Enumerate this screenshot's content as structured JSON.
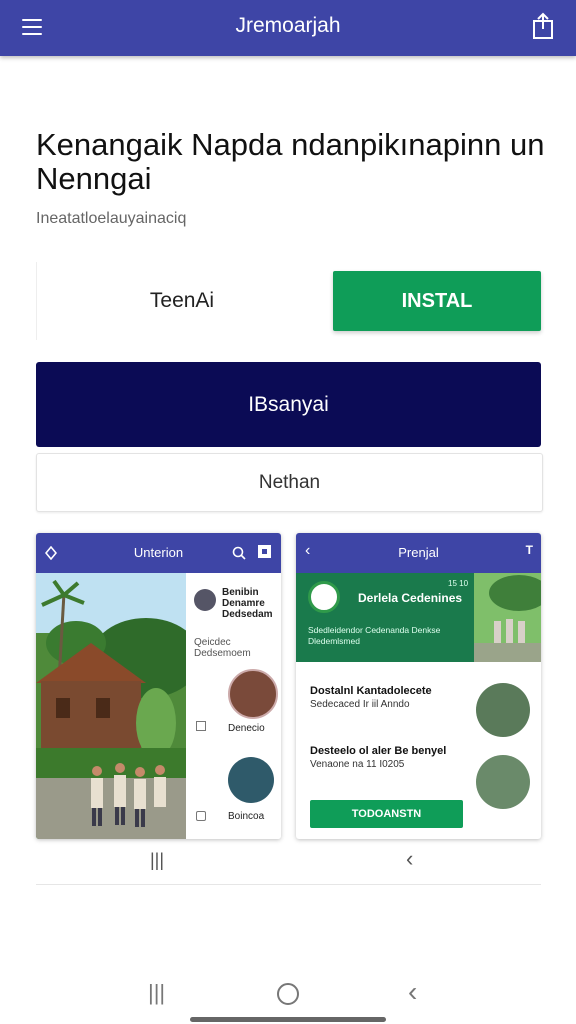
{
  "app_bar": {
    "title": "Jremoarjah"
  },
  "headline": "Kenangaik Napda ndanpikınapinn un Nenngai",
  "subline": "Ineatatloelauyainaciq",
  "buttons": {
    "open_label": "TeenAi",
    "install_label": "INSTAL",
    "primary_label": "IBsanyai",
    "secondary_label": "Nethan"
  },
  "screenshot1": {
    "title": "Unterion",
    "side_text": "Benibin Denamre Dedsedam",
    "side_caption": "Qeicdec Dedsemoem",
    "label_1": "Denecio",
    "label_2": "Boincoa"
  },
  "screenshot2": {
    "title": "Prenjal",
    "badge": "15 10",
    "banner_title": "Derlela Cedenines",
    "banner_sub": "Sdedleidendor Cedenanda Denkse Dledemlsmed",
    "row1_title": "Dostalnl Kantadolecete",
    "row1_sub": "Sedecaced Ir iil Anndo",
    "row2_title": "Desteelo ol aler Be benyel",
    "row2_sub": "Venaone na 11 I0205",
    "button_label": "TODOANSTN"
  },
  "colors": {
    "app_bar": "#3e45a6",
    "install": "#0f9d58",
    "primary": "#0b0b55"
  }
}
